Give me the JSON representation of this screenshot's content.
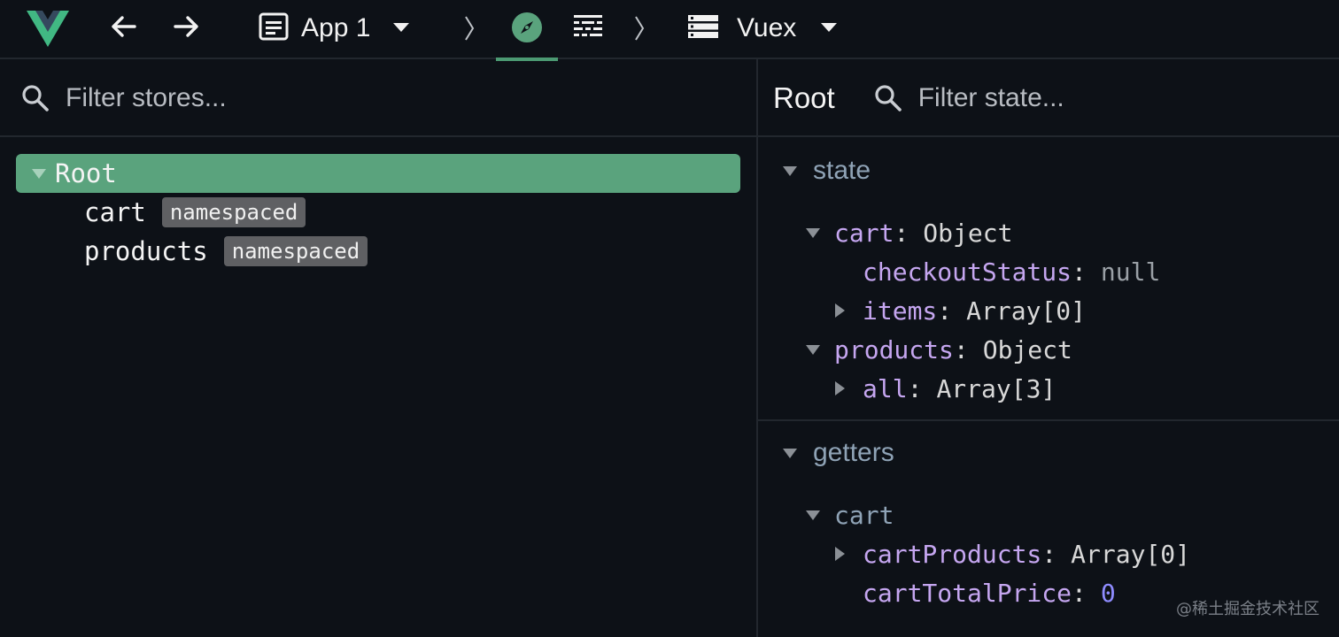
{
  "toolbar": {
    "app_selector": {
      "label": "App 1"
    },
    "store_selector": {
      "label": "Vuex"
    }
  },
  "colors": {
    "accent": "#5aa37d",
    "tab_underline": "#4c9a73",
    "key": "#c5a6f0",
    "section": "#8fa3b6",
    "number": "#8f8cff"
  },
  "icons": {
    "logo": "vue-logo-icon",
    "back": "arrow-left-icon",
    "forward": "arrow-right-icon",
    "app": "app-window-icon",
    "timeline": "compass-icon",
    "components": "component-list-icon",
    "store": "stacked-list-icon",
    "search": "search-icon"
  },
  "stores_panel": {
    "filter_placeholder": "Filter stores...",
    "tree": {
      "root": {
        "label": "Root",
        "selected": true,
        "expanded": true
      },
      "children": [
        {
          "label": "cart",
          "tag": "namespaced"
        },
        {
          "label": "products",
          "tag": "namespaced"
        }
      ]
    }
  },
  "state_panel": {
    "title": "Root",
    "filter_placeholder": "Filter state...",
    "state": {
      "section_label": "state",
      "cart": {
        "key": "cart",
        "sep": ":",
        "type": "Object"
      },
      "checkoutStatus": {
        "key": "checkoutStatus",
        "sep": ":",
        "value": "null"
      },
      "items": {
        "key": "items",
        "sep": ":",
        "value": "Array[0]"
      },
      "products": {
        "key": "products",
        "sep": ":",
        "type": "Object"
      },
      "all": {
        "key": "all",
        "sep": ":",
        "value": "Array[3]"
      }
    },
    "getters": {
      "section_label": "getters",
      "cart": {
        "label": "cart"
      },
      "cartProducts": {
        "key": "cartProducts",
        "sep": ":",
        "value": "Array[0]"
      },
      "cartTotalPrice": {
        "key": "cartTotalPrice",
        "sep": ":",
        "value": "0"
      }
    }
  },
  "watermark": "@稀土掘金技术社区"
}
